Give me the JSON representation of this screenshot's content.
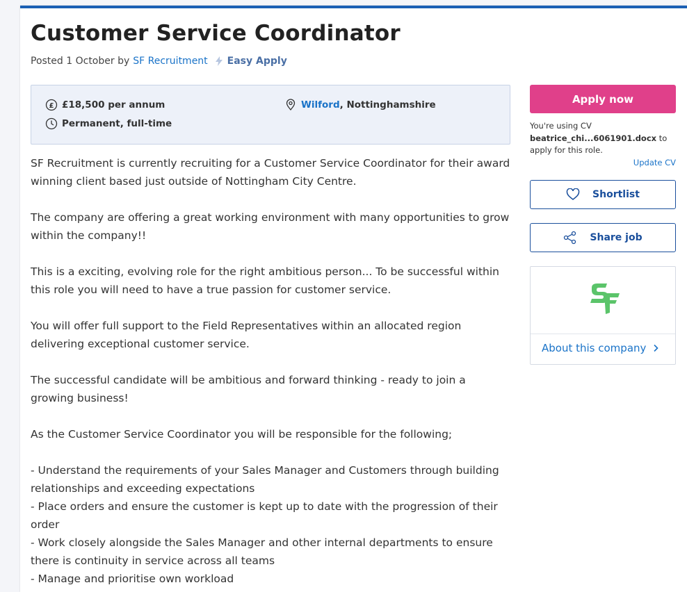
{
  "job": {
    "title": "Customer Service Coordinator",
    "posted_prefix": "Posted 1 October by",
    "recruiter": "SF Recruitment",
    "easy_apply": "Easy Apply"
  },
  "summary": {
    "salary": "£18,500 per annum",
    "contract": "Permanent, full-time",
    "location_link": "Wilford",
    "location_rest": ", Nottinghamshire"
  },
  "description": {
    "paragraphs": [
      "SF Recruitment is currently recruiting for a Customer Service Coordinator for their award winning client based just outside of Nottingham City Centre.",
      "The company are offering a great working environment with many opportunities to grow within the company!!",
      "This is a exciting, evolving role for the right ambitious person... To be successful within this role you will need to have a true passion for customer service.",
      "You will offer full support to the Field Representatives within an allocated region delivering exceptional customer service.",
      "The successful candidate will be ambitious and forward thinking - ready to join a growing business!",
      "As the Customer Service Coordinator you will be responsible for the following;"
    ],
    "bullets": [
      "- Understand the requirements of your Sales Manager and Customers through building relationships and exceeding expectations",
      "- Place orders and ensure the customer is kept up to date with the progression of their order",
      "- Work closely alongside the Sales Manager and other internal departments to ensure there is continuity in service across all teams",
      "- Manage and prioritise own workload"
    ]
  },
  "sidebar": {
    "apply_label": "Apply now",
    "cv_prefix": "You're using CV",
    "cv_file": "beatrice_chi...6061901.docx",
    "cv_suffix": "to apply for this role.",
    "update_cv": "Update CV",
    "shortlist": "Shortlist",
    "share": "Share job",
    "about_company": "About this company"
  },
  "colors": {
    "accent_pink": "#e0408a",
    "link_blue": "#1a73c8",
    "top_bar": "#1a5fb4"
  }
}
